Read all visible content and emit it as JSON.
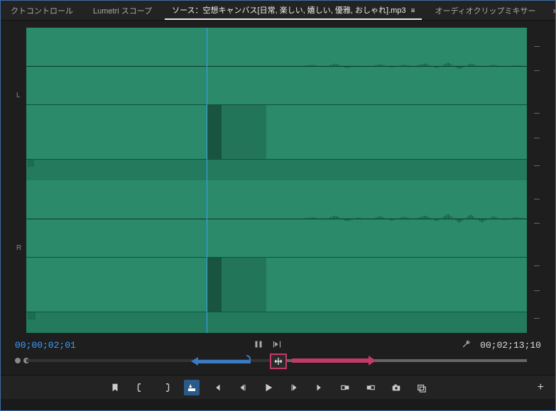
{
  "tabs": {
    "effect_controls": "クトコントロール",
    "lumetri_scopes": "Lumetri スコープ",
    "source": "ソース：空想キャンバス[日常, 楽しい, 嬉しい, 優雅, おしゃれ].mp3",
    "audio_clip_mixer": "オーディオクリップミキサー",
    "menu_glyph": "≡",
    "overflow": "»"
  },
  "channels": {
    "left": "L",
    "right": "R",
    "left_mini": "L",
    "right_mini": "R"
  },
  "timecode": {
    "current": "00;00;02;01",
    "duration": "00;02;13;10"
  },
  "icons": {
    "marker_brackets": "{ }",
    "in_out_braces": "{▸}",
    "wrench": "🔧",
    "drag_cursor": "⇹"
  },
  "transport": {
    "marker": "marker",
    "in": "mark-in",
    "out": "mark-out",
    "insert": "insert",
    "goto_in": "go-to-in",
    "step_back": "step-back",
    "play": "play",
    "step_fwd": "step-forward",
    "goto_out": "go-to-out",
    "overwrite": "overwrite",
    "export_frame": "export-frame",
    "camera": "camera",
    "loop": "loop",
    "add": "+"
  }
}
